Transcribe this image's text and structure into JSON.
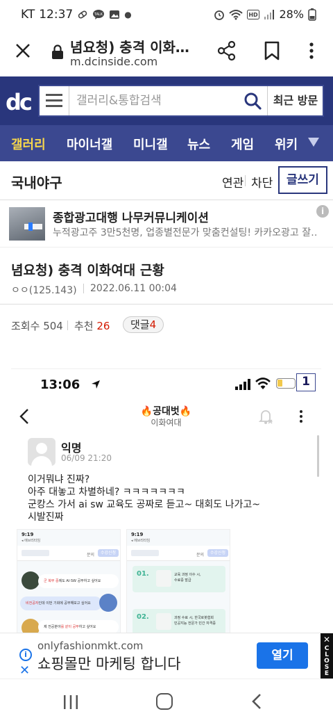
{
  "status_bar": {
    "carrier": "KT",
    "time": "12:37",
    "battery": "28%"
  },
  "browser": {
    "page_title": "념요청) 충격 이화…",
    "url": "m.dcinside.com",
    "icons": [
      "close-icon",
      "lock-icon",
      "share-icon",
      "bookmark-icon",
      "more-icon"
    ]
  },
  "site_header": {
    "logo_text": "dc",
    "search_placeholder": "갤러리&통합검색",
    "recent_label": "최근 방문"
  },
  "nav": {
    "items": [
      {
        "label": "갤러리"
      },
      {
        "label": "마이너갤"
      },
      {
        "label": "미니갤"
      },
      {
        "label": "뉴스"
      },
      {
        "label": "게임"
      },
      {
        "label": "위키"
      }
    ],
    "active_color": "#f8d74b",
    "bar_color": "#3b4890"
  },
  "gallery": {
    "name": "국내야구",
    "related": "연관",
    "block": "차단",
    "write": "글쓰기"
  },
  "ad": {
    "title": "종합광고대행 나무커뮤니케이션",
    "desc": "누적광고주 3만5천명, 업종별전문가 맞춤컨설팅! 카카오광고 잘…",
    "info": "i"
  },
  "post": {
    "title": "념요청) 충격 이화여대 근황",
    "author": "ㅇㅇ(125.143)",
    "date": "2022.06.11 00:04"
  },
  "stats": {
    "views_label": "조회수",
    "views": "504",
    "recommend_label": "추천",
    "recommend": "26",
    "comments_label": "댓글",
    "comments": "4"
  },
  "embedded": {
    "time": "13:06",
    "badge": "1",
    "board_title": "🔥공대벗🔥",
    "school": "이화여대",
    "author": "익명",
    "posted": "06/09 21:20",
    "lines": [
      "이거뭐냐 진짜?",
      "아주 대놓고 차별하네? ㅋㅋㅋㅋㅋㅋㅋ",
      "군캉스 가서 ai sw 교육도 공짜로 듣고~ 대회도 나가고~",
      "시발진짜"
    ],
    "shot_left": {
      "time": "9:19",
      "back": "◂ 에브리타임",
      "q": "문의",
      "btn": "수강신청",
      "bubbles": [
        {
          "pre": "",
          "hi": "군 복무 중",
          "post": "에도 AI·SW 공부하고 싶어요"
        },
        {
          "pre": "",
          "hi": "비전공자",
          "post": "인데 이번 기회에 공부해보고 싶어요"
        },
        {
          "pre": "제 전공분야",
          "hi": "를 같이 공부",
          "post": "하고 싶어요"
        }
      ]
    },
    "shot_right": {
      "time": "9:19",
      "back": "◂ 에브리타임",
      "q": "문의",
      "btn": "수강신청",
      "cards": [
        {
          "num": "01.",
          "text1": "교육 과정 이수 시,",
          "text2": "수료증 발급"
        },
        {
          "num": "02.",
          "text1": "과정 수료 시, 한국로봇협회",
          "text2": "민공지능 전문가 민간 자격증"
        }
      ]
    }
  },
  "bottom_ad": {
    "domain": "onlyfashionmkt.com",
    "title": "쇼핑몰만 마케팅 합니다",
    "button": "열기",
    "close_label": "CLOSE",
    "close_x": "✕"
  },
  "system_nav": {
    "icons": [
      "recent-apps-icon",
      "home-icon",
      "back-icon"
    ]
  }
}
